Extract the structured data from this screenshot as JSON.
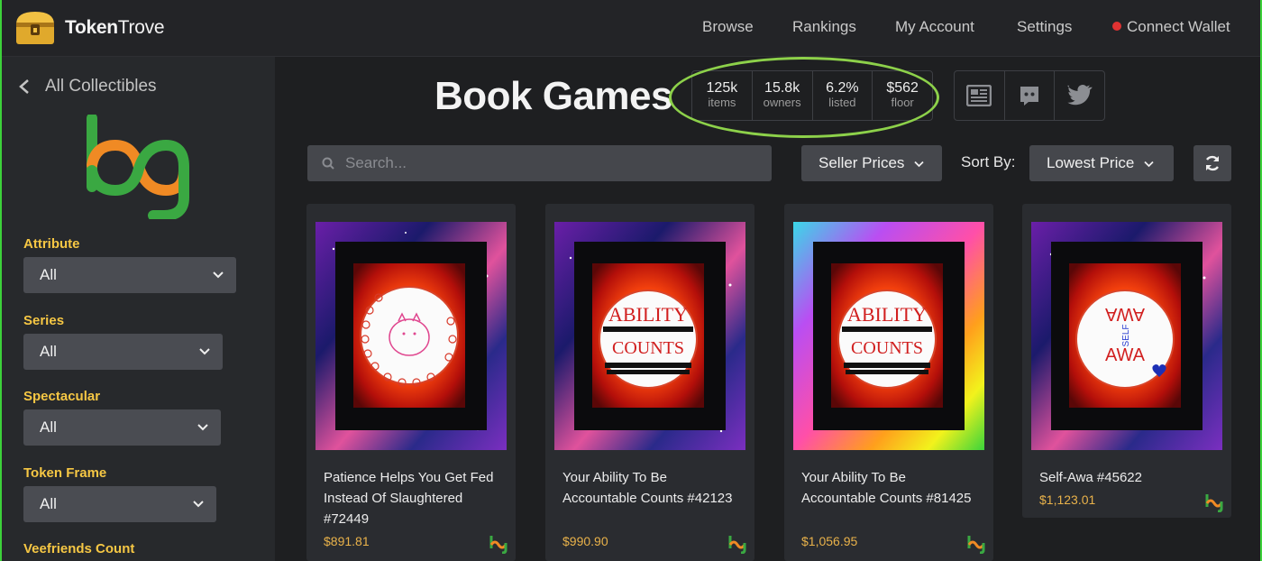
{
  "nav": {
    "brand_bold": "Token",
    "brand_thin": "Trove",
    "links": [
      "Browse",
      "Rankings",
      "My Account",
      "Settings"
    ],
    "connect": "Connect Wallet"
  },
  "sidebar": {
    "back_label": "All Collectibles",
    "filters": [
      {
        "label": "Attribute",
        "value": "All"
      },
      {
        "label": "Series",
        "value": "All"
      },
      {
        "label": "Spectacular",
        "value": "All"
      },
      {
        "label": "Token Frame",
        "value": "All"
      },
      {
        "label": "Veefriends Count",
        "value": ""
      }
    ]
  },
  "collection": {
    "title": "Book Games",
    "stats": [
      {
        "value": "125k",
        "label": "items"
      },
      {
        "value": "15.8k",
        "label": "owners"
      },
      {
        "value": "6.2%",
        "label": "listed"
      },
      {
        "value": "$562",
        "label": "floor"
      }
    ]
  },
  "toolbar": {
    "search_placeholder": "Search...",
    "price_filter": "Seller Prices",
    "sort_label": "Sort By:",
    "sort_value": "Lowest Price"
  },
  "cards": [
    {
      "title": "Patience Helps You Get Fed Instead Of Slaughtered #72449",
      "price": "$891.81"
    },
    {
      "title": "Your Ability To Be Accountable Counts #42123",
      "price": "$990.90"
    },
    {
      "title": "Your Ability To Be Accountable Counts #81425",
      "price": "$1,056.95"
    },
    {
      "title": "Self-Awa #45622",
      "price": "$1,123.01"
    }
  ],
  "artwork_text": {
    "ability_line1": "ABILITY",
    "ability_line2": "COUNTS",
    "selfawa_top": "AWA",
    "selfawa_mid": "SELF",
    "selfawa_bottom": "AWA"
  },
  "colors": {
    "accent_yellow": "#f6c744",
    "price_gold": "#e9b24a",
    "highlight_green": "#8dd14a",
    "wallet_dot": "#e03232"
  }
}
